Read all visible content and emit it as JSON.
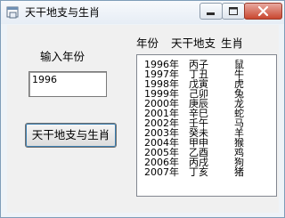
{
  "window": {
    "title": "天干地支与生肖",
    "icon": "app-window-icon"
  },
  "form": {
    "year_label": "输入年份",
    "year_value": "1996",
    "convert_button": "天干地支与生肖"
  },
  "table": {
    "headers": [
      "年份",
      "天干地支",
      "生肖"
    ],
    "rows": [
      {
        "year": "1996年",
        "stem_branch": "丙子",
        "zodiac": "鼠"
      },
      {
        "year": "1997年",
        "stem_branch": "丁丑",
        "zodiac": "牛"
      },
      {
        "year": "1998年",
        "stem_branch": "戊寅",
        "zodiac": "虎"
      },
      {
        "year": "1999年",
        "stem_branch": "己卯",
        "zodiac": "兔"
      },
      {
        "year": "2000年",
        "stem_branch": "庚辰",
        "zodiac": "龙"
      },
      {
        "year": "2001年",
        "stem_branch": "辛巳",
        "zodiac": "蛇"
      },
      {
        "year": "2002年",
        "stem_branch": "壬午",
        "zodiac": "马"
      },
      {
        "year": "2003年",
        "stem_branch": "癸未",
        "zodiac": "羊"
      },
      {
        "year": "2004年",
        "stem_branch": "甲申",
        "zodiac": "猴"
      },
      {
        "year": "2005年",
        "stem_branch": "乙酉",
        "zodiac": "鸡"
      },
      {
        "year": "2006年",
        "stem_branch": "丙戌",
        "zodiac": "狗"
      },
      {
        "year": "2007年",
        "stem_branch": "丁亥",
        "zodiac": "猪"
      }
    ]
  }
}
